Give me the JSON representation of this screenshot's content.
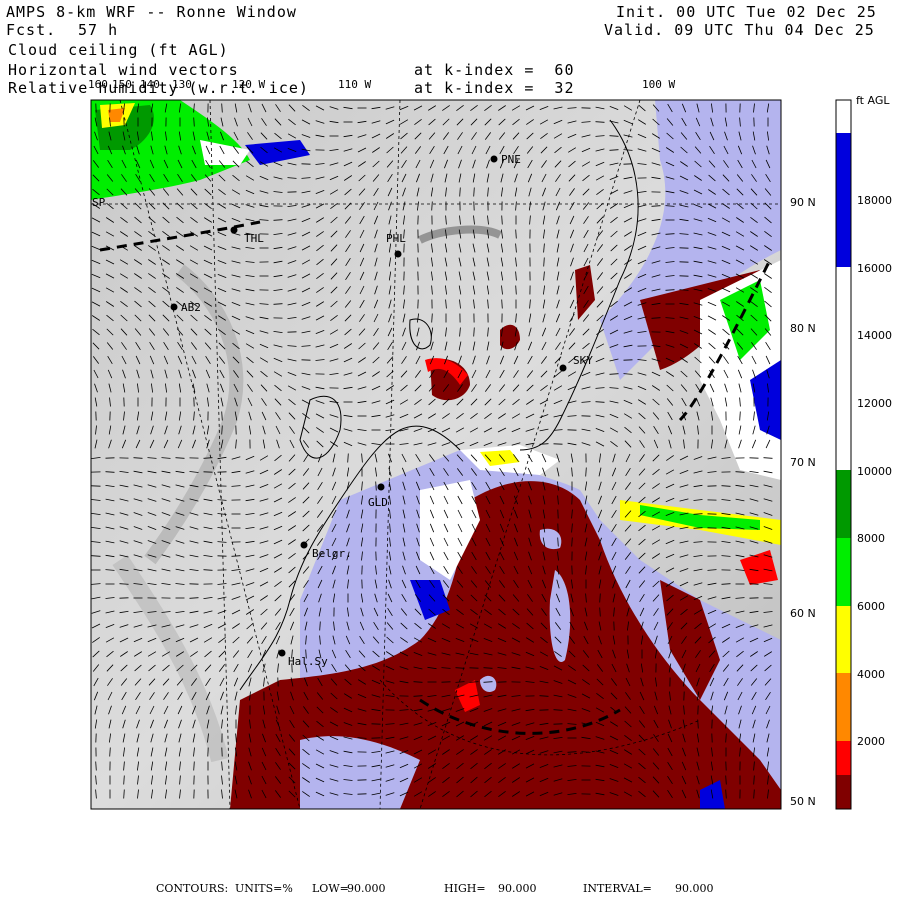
{
  "header": {
    "title": "AMPS 8-km WRF -- Ronne Window",
    "fcst_label": "Fcst.",
    "fcst_value": "57 h",
    "init": "Init. 00 UTC Tue 02 Dec 25",
    "valid": "Valid. 09 UTC Thu 04 Dec 25",
    "field1": "Cloud ceiling (ft AGL)",
    "field2": "Horizontal wind vectors",
    "field3": "Relative humidity (w.r.t. ice)",
    "k1": "at k-index =  60",
    "k2": "at k-index =  32"
  },
  "lon_labels": [
    "160",
    "150",
    "140",
    "130",
    "120 W",
    "110 W",
    "100 W"
  ],
  "lat_labels": [
    "90 N",
    "80 N",
    "70 N",
    "60 N",
    "50 N"
  ],
  "stations": [
    "SP",
    "THL",
    "PHL",
    "PNE",
    "AB2",
    "SKY",
    "GLD",
    "Belgr.",
    "Hal.Sy"
  ],
  "colorbar": {
    "unit": "ft AGL",
    "ticks": [
      "18000",
      "16000",
      "14000",
      "12000",
      "10000",
      "8000",
      "6000",
      "4000",
      "2000"
    ],
    "colors": {
      "above_18000": "#ffffff",
      "16000_18000": "#0000dd",
      "10000_16000": "#ffffff",
      "8000_10000": "#009900",
      "6000_8000": "#00ee00",
      "4000_6000": "#ffff00",
      "2000_4000": "#ff8800",
      "1000_2000": "#ff0000",
      "0_1000": "#800000"
    }
  },
  "legend_colors": {
    "humid_region": "#b4b4ee",
    "terrain_light": "#d0d0d0",
    "terrain_dark": "#9a9a9a"
  },
  "footer": {
    "contours": "CONTOURS:",
    "units": "UNITS=%",
    "low": "LOW=",
    "low_value": "90.000",
    "high": "HIGH=",
    "high_value": "90.000",
    "interval": "INTERVAL=",
    "interval_value": "90.000"
  }
}
